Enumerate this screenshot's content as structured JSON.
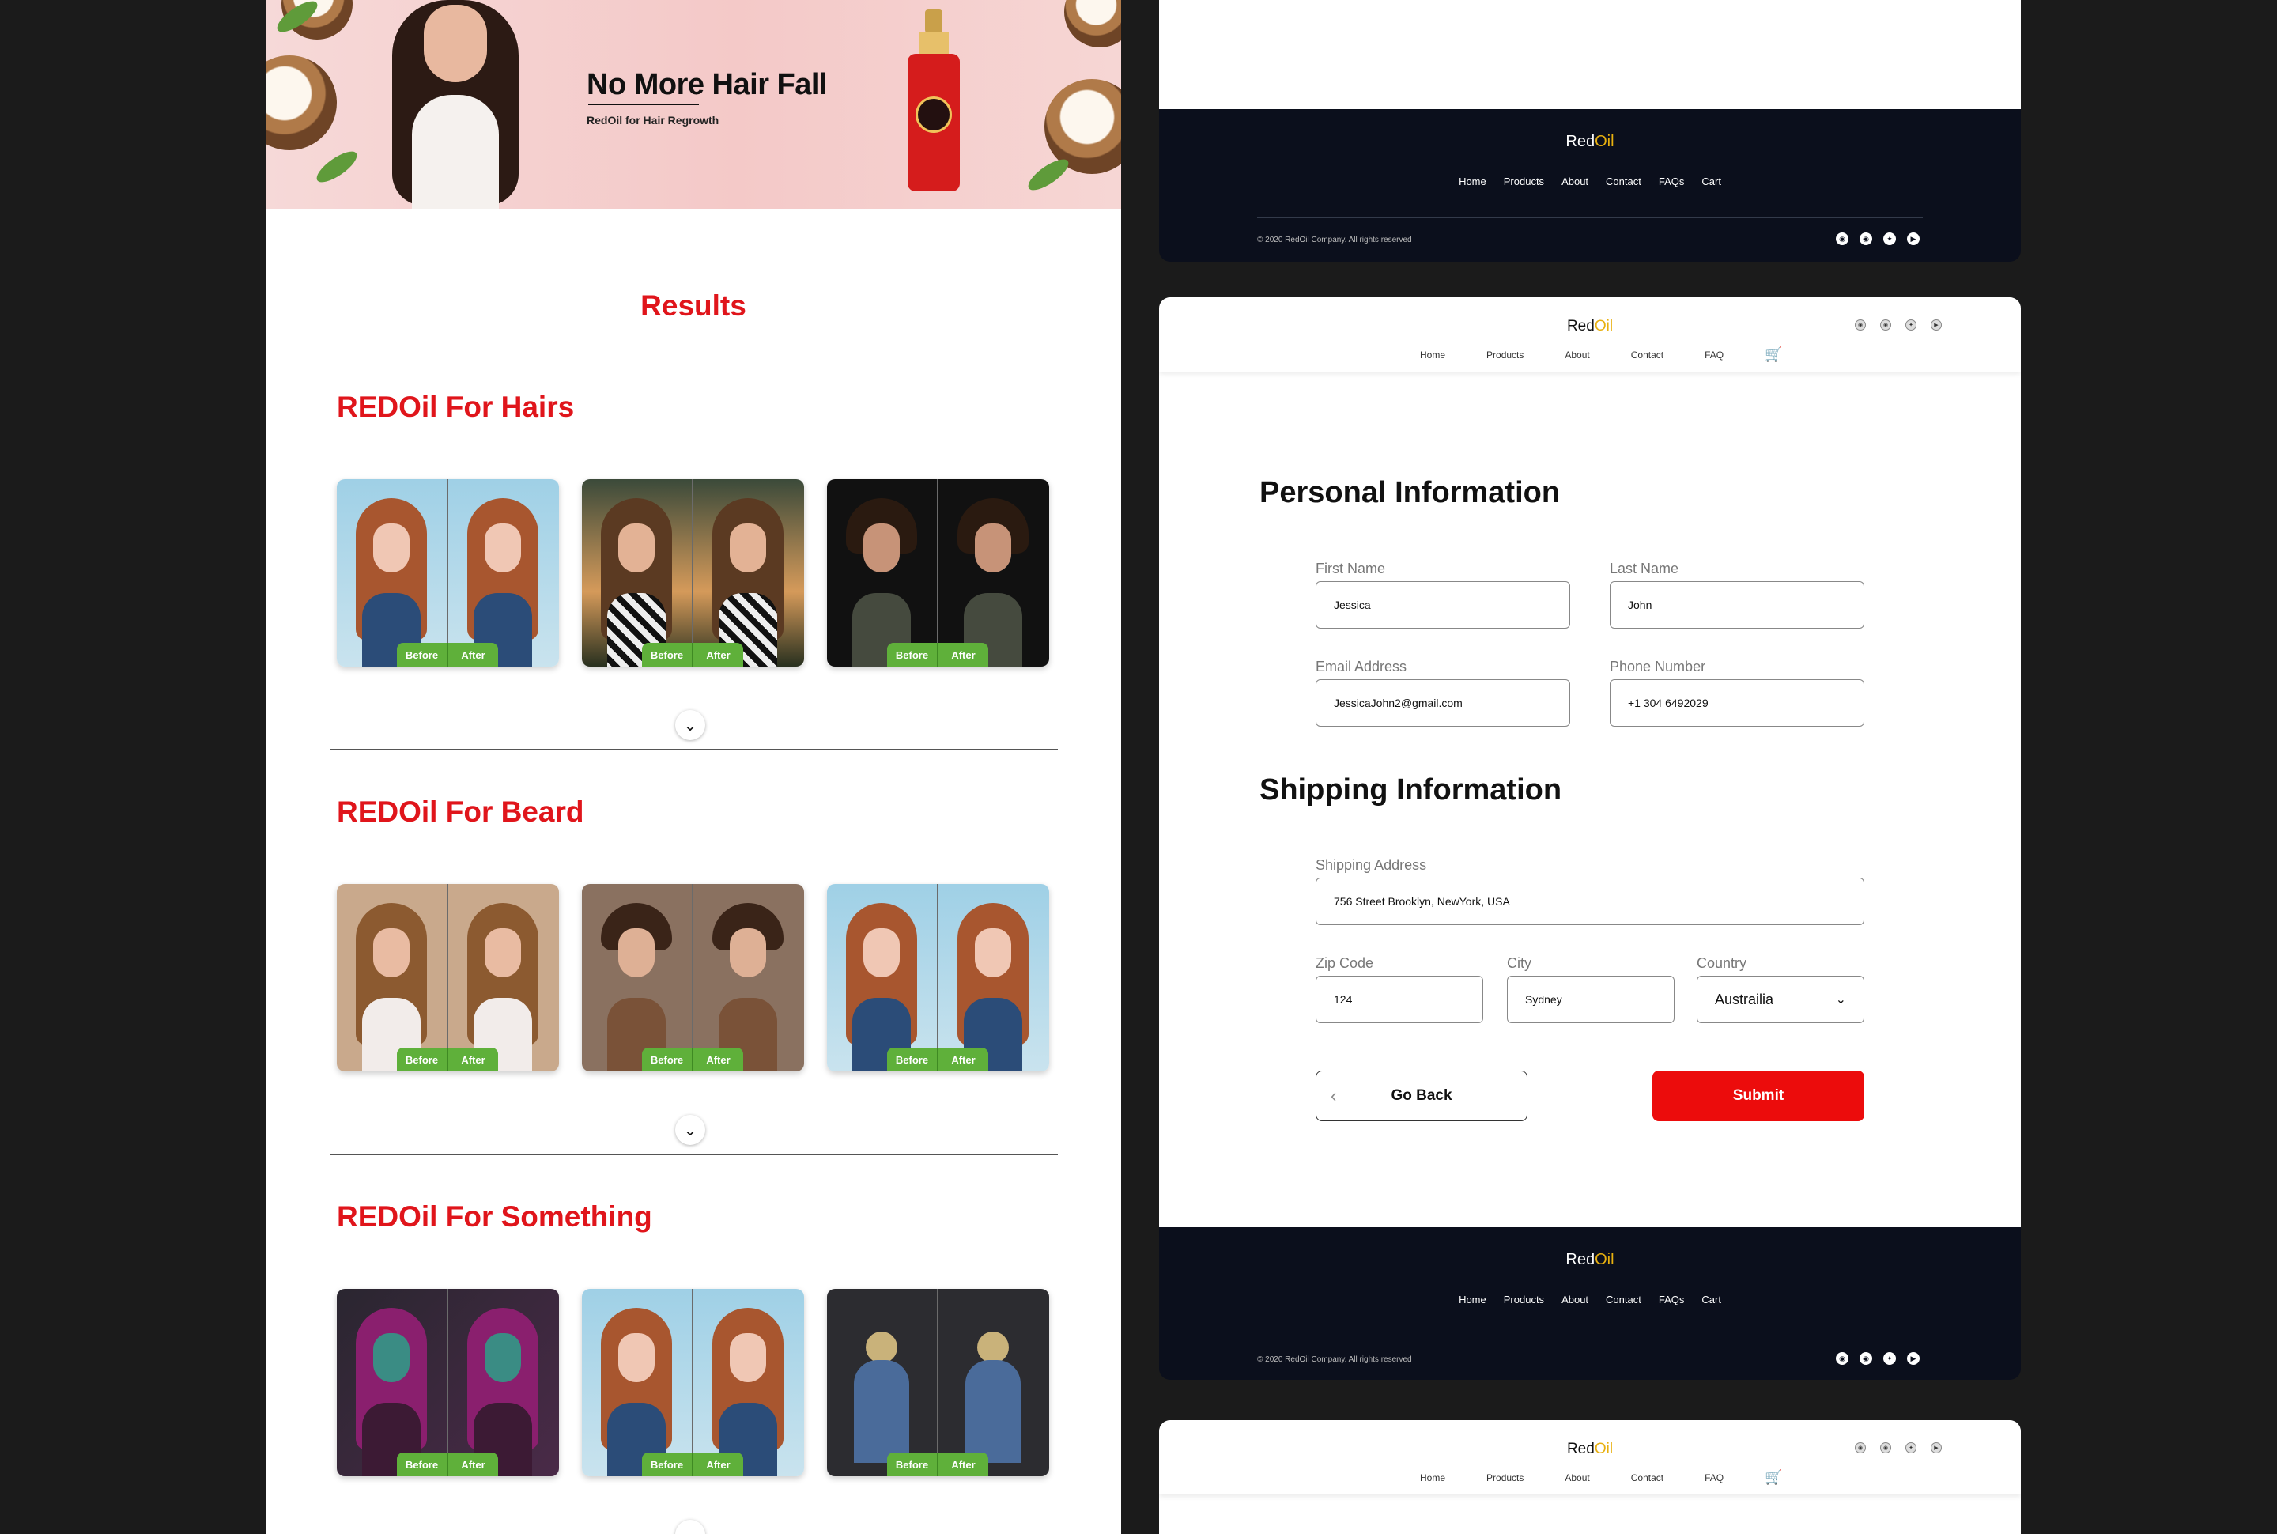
{
  "hero": {
    "title": "No More Hair Fall",
    "subtitle": "RedOil for Hair Regrowth"
  },
  "results_title": "Results",
  "sections": [
    {
      "title": "REDOil For Hairs",
      "before": "Before",
      "after": "After"
    },
    {
      "title": "REDOil For Beard",
      "before": "Before",
      "after": "After"
    },
    {
      "title": "REDOil For Something",
      "before": "Before",
      "after": "After"
    }
  ],
  "expand_icon": "chevron-down-icon",
  "footer": {
    "brand_red": "Red",
    "brand_oil": "Oil",
    "links": [
      "Home",
      "Products",
      "About",
      "Contact",
      "FAQs",
      "Cart"
    ],
    "copyright": "© 2020 RedOil Company. All rights reserved",
    "social_icons": [
      "instagram-icon",
      "pinterest-icon",
      "twitter-icon",
      "youtube-icon"
    ]
  },
  "nav": {
    "brand_red": "Red",
    "brand_oil": "Oil",
    "links": [
      "Home",
      "Products",
      "About",
      "Contact",
      "FAQ"
    ],
    "cart_icon": "cart-icon",
    "social_icons": [
      "instagram-icon",
      "pinterest-icon",
      "twitter-icon",
      "youtube-icon"
    ]
  },
  "form": {
    "personal_title": "Personal Information",
    "first_name": {
      "label": "First Name",
      "value": "Jessica"
    },
    "last_name": {
      "label": "Last Name",
      "value": "John"
    },
    "email": {
      "label": "Email Address",
      "value": "JessicaJohn2@gmail.com"
    },
    "phone": {
      "label": "Phone Number",
      "value": "+1 304 6492029"
    },
    "shipping_title": "Shipping Information",
    "address": {
      "label": "Shipping Address",
      "value": "756 Street Brooklyn, NewYork, USA"
    },
    "zip": {
      "label": "Zip Code",
      "value": "124"
    },
    "city": {
      "label": "City",
      "value": "Sydney"
    },
    "country": {
      "label": "Country",
      "value": "Austrailia"
    },
    "back_label": "Go Back",
    "submit_label": "Submit"
  },
  "colors": {
    "accent": "#e0151b",
    "submit": "#ec0c0c",
    "footer_bg": "#0b0f1c",
    "brand_oil": "#e8b00f",
    "tag_green": "#5fb03a"
  }
}
